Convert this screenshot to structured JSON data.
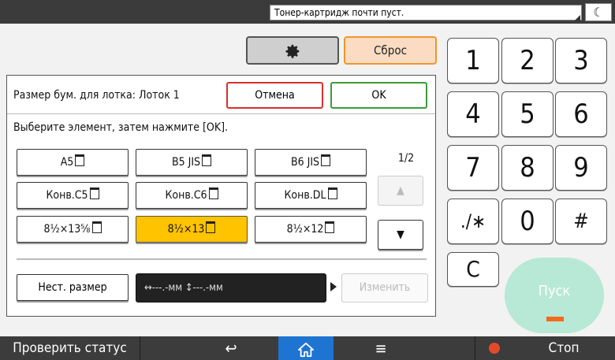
{
  "status_bar": {
    "message": "Тонер-картридж почти пуст."
  },
  "top_buttons": {
    "reset_label": "Сброс"
  },
  "dialog": {
    "title": "Размер бум. для лотка: Лоток 1",
    "cancel_label": "Отмена",
    "ok_label": "OK",
    "instruction": "Выберите элемент, затем нажмите [OK].",
    "options": [
      {
        "label": "A5",
        "selected": false
      },
      {
        "label": "B5 JIS",
        "selected": false
      },
      {
        "label": "B6 JIS",
        "selected": false
      },
      {
        "label": "Конв.C5",
        "selected": false
      },
      {
        "label": "Конв.C6",
        "selected": false
      },
      {
        "label": "Конв.DL",
        "selected": false
      },
      {
        "label": "8½×13⅝",
        "selected": false
      },
      {
        "label": "8½×13",
        "selected": true
      },
      {
        "label": "8½×12",
        "selected": false
      }
    ],
    "page_indicator": "1/2",
    "custom_size_label": "Нест. размер",
    "dimensions_display": "↔---.-мм ↕---.-мм",
    "change_label": "Изменить"
  },
  "keypad": {
    "keys": [
      "1",
      "2",
      "3",
      "4",
      "5",
      "6",
      "7",
      "8",
      "9",
      "./∗",
      "0",
      "#",
      "C"
    ],
    "start_label": "Пуск"
  },
  "bottom_bar": {
    "check_status_label": "Проверить статус",
    "stop_label": "Стоп"
  },
  "colors": {
    "selected_option": "#ffc300",
    "reset_border": "#f0962a",
    "cancel_border": "#d9302c",
    "ok_border": "#3b9b3b",
    "home_active": "#1e74d1",
    "start_button": "#b8e8d6"
  },
  "icons": {
    "gear": "gear-icon",
    "moon": "moon-icon",
    "back": "back-arrow-icon",
    "home": "home-icon",
    "menu": "menu-icon",
    "stop": "stop-icon"
  }
}
